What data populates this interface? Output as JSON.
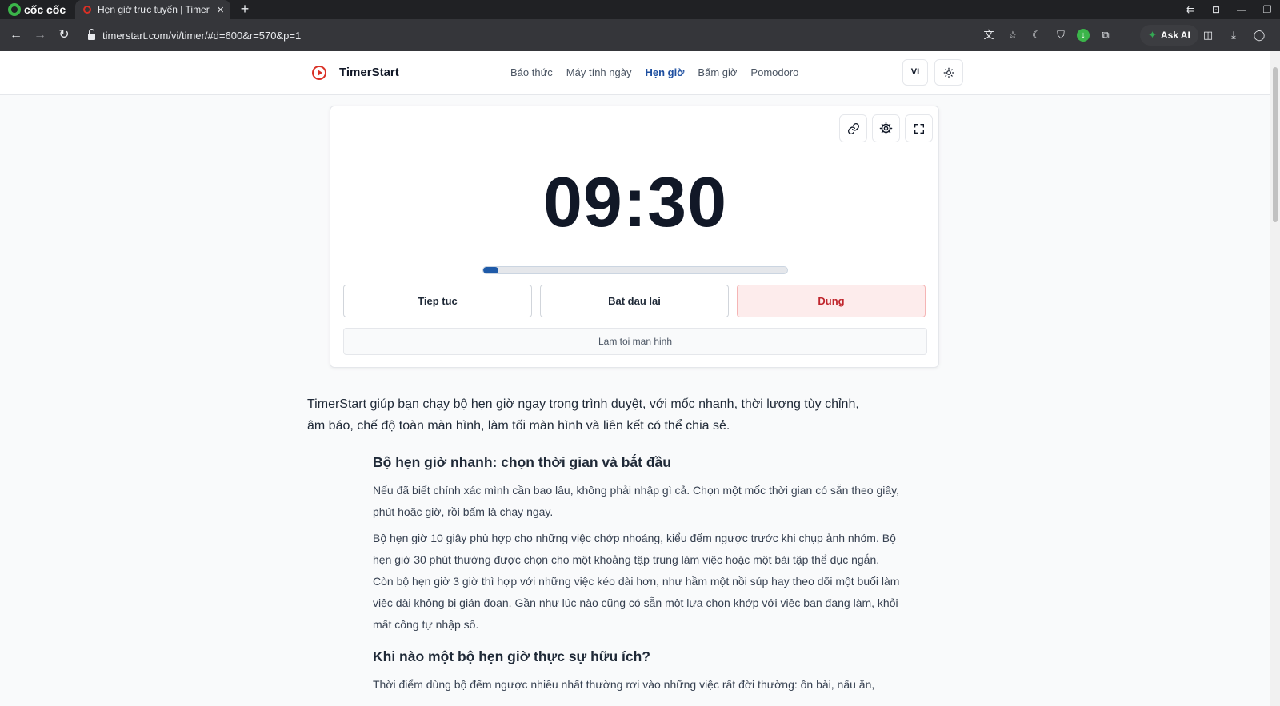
{
  "browser": {
    "brand": "cốc cốc",
    "tab_title": "Hẹn giờ trực tuyến | TimerSt",
    "url": "timerstart.com/vi/timer/#d=600&r=570&p=1",
    "ask_ai_label": "Ask AI",
    "icons": [
      "back-icon",
      "forward-icon",
      "reload-icon",
      "lock-icon",
      "translate-icon",
      "star-icon",
      "moon-icon",
      "shield-icon",
      "download-badge-icon",
      "extensions-icon",
      "sidebar-icon",
      "downloads-icon",
      "profile-icon"
    ]
  },
  "site": {
    "name": "TimerStart",
    "nav": [
      {
        "label": "Báo thức",
        "active": false
      },
      {
        "label": "Máy tính ngày",
        "active": false
      },
      {
        "label": "Hẹn giờ",
        "active": true
      },
      {
        "label": "Bấm giờ",
        "active": false
      },
      {
        "label": "Pomodoro",
        "active": false
      }
    ],
    "lang": "VI"
  },
  "timer": {
    "display": "09:30",
    "progress": 0.05,
    "buttons": {
      "resume": "Tiep tuc",
      "restart": "Bat dau lai",
      "stop": "Dung",
      "dim": "Lam toi man hinh"
    },
    "colors": {
      "progress": "#1e5aa8",
      "stop_bg": "#fdecec",
      "stop_text": "#c0262d"
    }
  },
  "content": {
    "intro": "TimerStart giúp bạn chạy bộ hẹn giờ ngay trong trình duyệt, với mốc nhanh, thời lượng tùy chỉnh, âm báo, chế độ toàn màn hình, làm tối màn hình và liên kết có thể chia sẻ.",
    "section1_heading": "Bộ hẹn giờ nhanh: chọn thời gian và bắt đầu",
    "section1_p1": "Nếu đã biết chính xác mình cần bao lâu, không phải nhập gì cả. Chọn một mốc thời gian có sẵn theo giây, phút hoặc giờ, rồi bấm là chạy ngay.",
    "section1_p2": "Bộ hẹn giờ 10 giây phù hợp cho những việc chớp nhoáng, kiểu đếm ngược trước khi chụp ảnh nhóm. Bộ hẹn giờ 30 phút thường được chọn cho một khoảng tập trung làm việc hoặc một bài tập thể dục ngắn. Còn bộ hẹn giờ 3 giờ thì hợp với những việc kéo dài hơn, như hầm một nồi súp hay theo dõi một buổi làm việc dài không bị gián đoạn. Gần như lúc nào cũng có sẵn một lựa chọn khớp với việc bạn đang làm, khỏi mất công tự nhập số.",
    "section2_heading": "Khi nào một bộ hẹn giờ thực sự hữu ích?",
    "section2_p1": "Thời điểm dùng bộ đếm ngược nhiều nhất thường rơi vào những việc rất đời thường: ôn bài, nấu ăn,"
  }
}
